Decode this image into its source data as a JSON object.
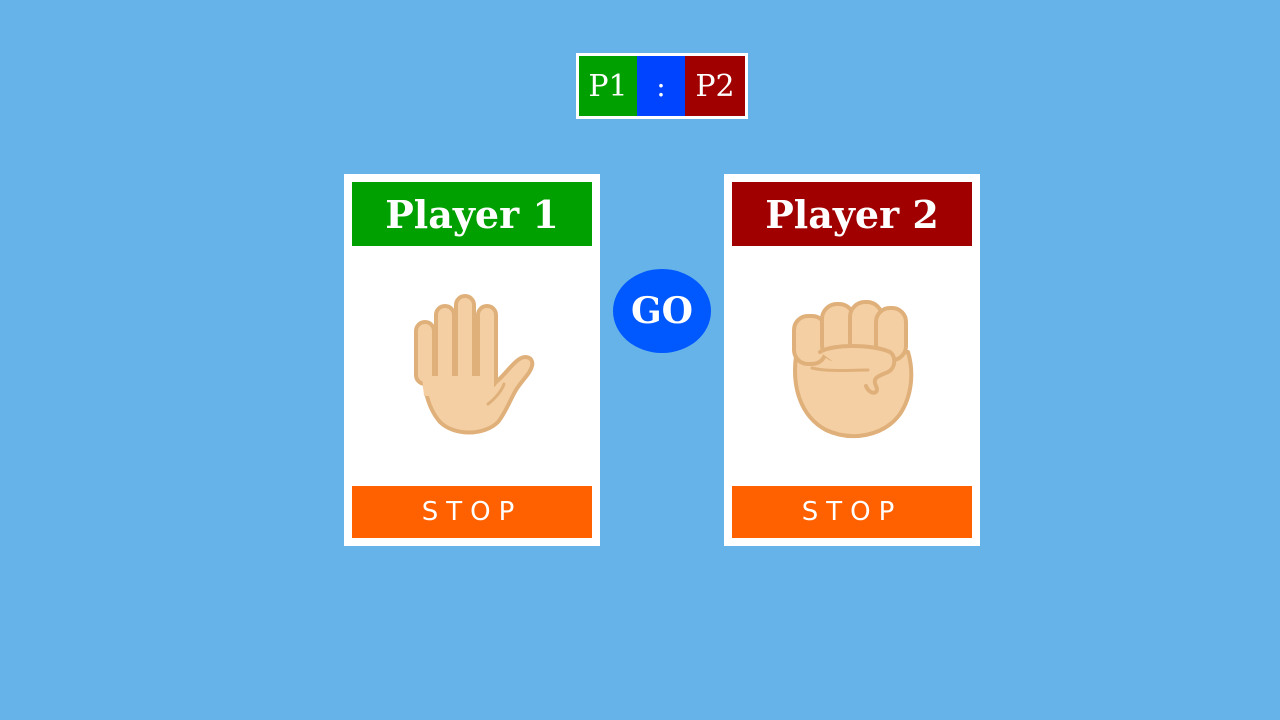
{
  "scoreboard": {
    "p1_label": "P1",
    "separator": ":",
    "p2_label": "P2"
  },
  "players": [
    {
      "title": "Player 1",
      "hand": "open-hand-icon",
      "stop_label": "STOP",
      "color": "#00a000"
    },
    {
      "title": "Player 2",
      "hand": "fist-icon",
      "stop_label": "STOP",
      "color": "#a00000"
    }
  ],
  "go_label": "GO",
  "colors": {
    "background": "#66b3ea",
    "stop": "#ff6000",
    "go": "#0058ff",
    "separator": "#0044ff",
    "skin": "#f4cfa3",
    "skin_outline": "#e0b07a"
  }
}
